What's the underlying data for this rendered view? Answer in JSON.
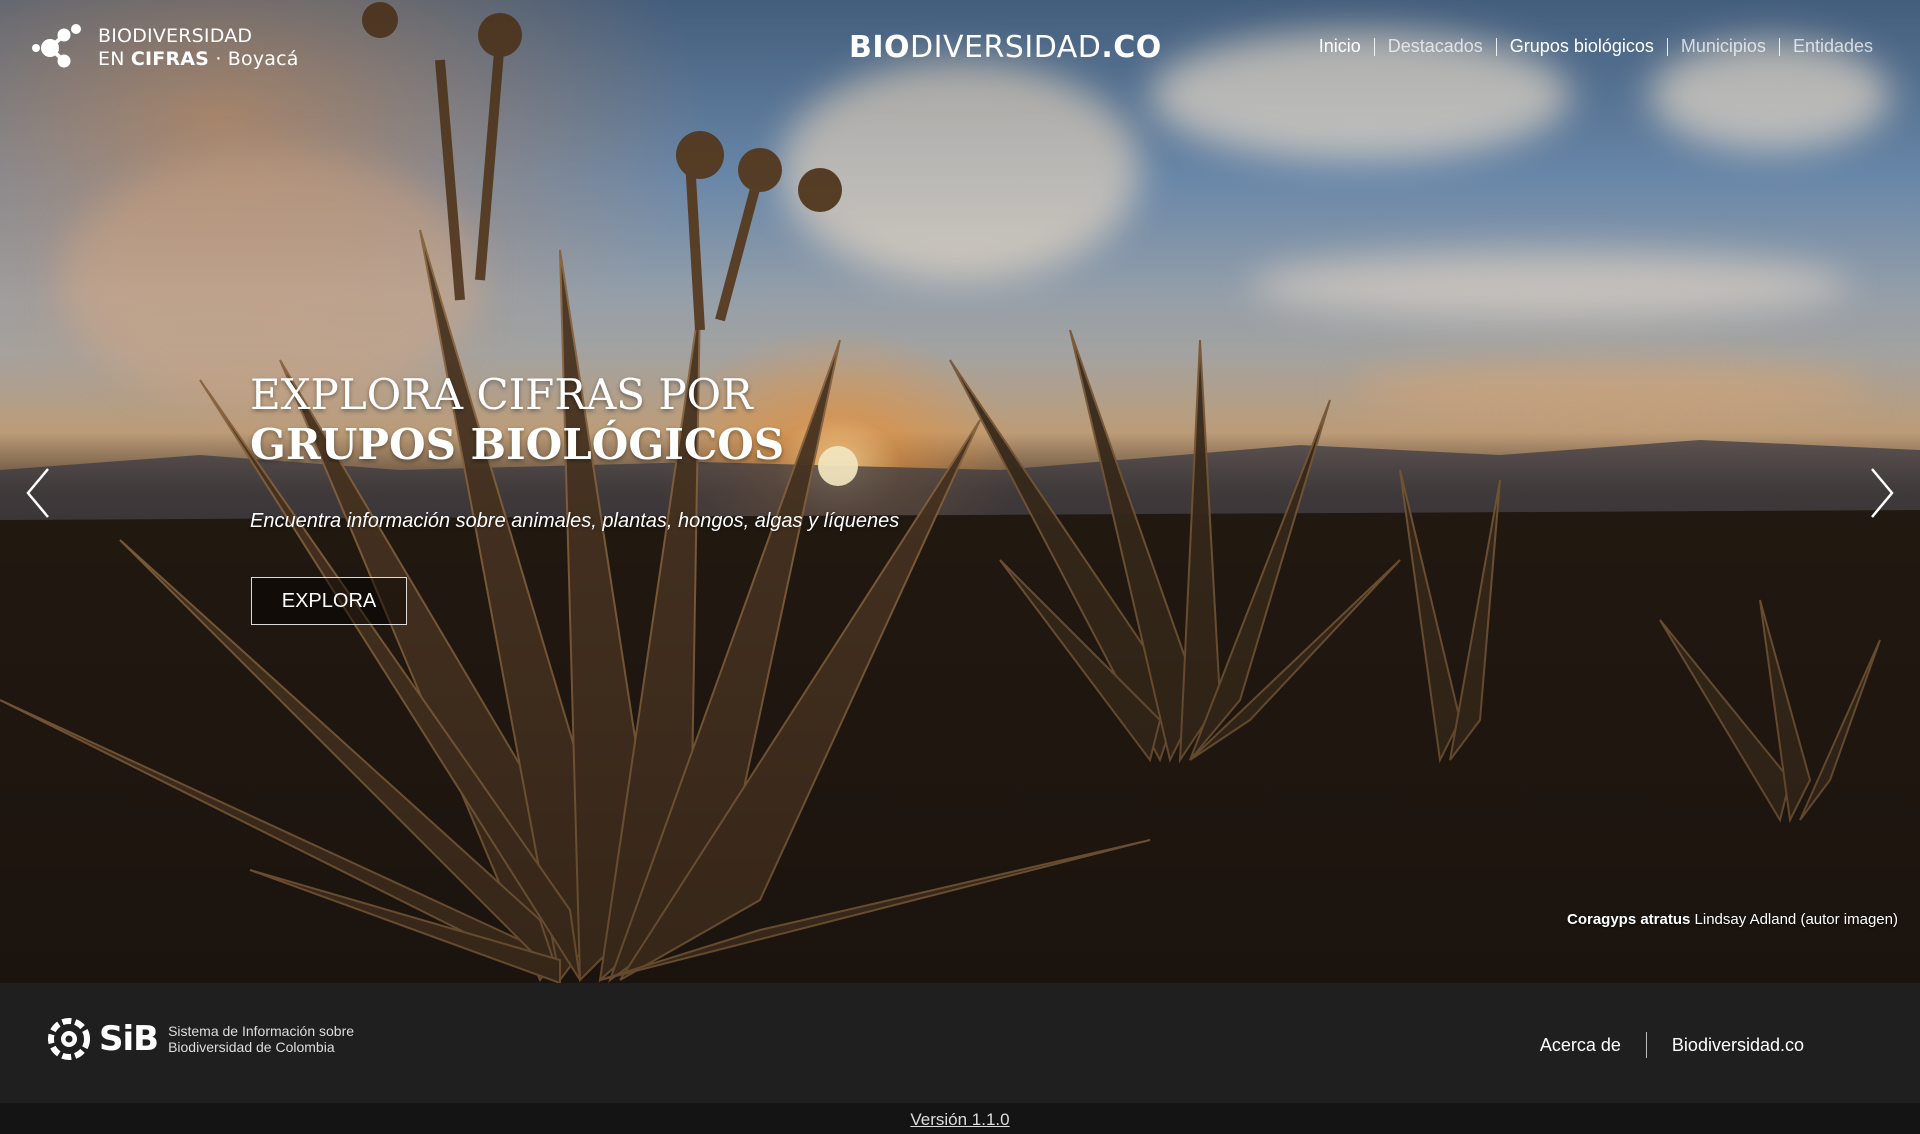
{
  "header": {
    "logo_line1": "BIODIVERSIDAD",
    "logo_line2_prefix": "EN ",
    "logo_line2_bold": "CIFRAS",
    "logo_line2_sep": " · ",
    "logo_region": "Boyacá",
    "brand_part1": "BIO",
    "brand_part2": "DIVERSIDAD",
    "brand_part3": ".CO"
  },
  "nav": {
    "items": [
      {
        "label": "Inicio"
      },
      {
        "label": "Destacados"
      },
      {
        "label": "Grupos biológicos"
      },
      {
        "label": "Municipios"
      },
      {
        "label": "Entidades"
      }
    ]
  },
  "hero": {
    "headline_line1": "EXPLORA CIFRAS POR",
    "headline_line2": "GRUPOS BIOLÓGICOS",
    "subtitle": "Encuentra información sobre animales, plantas, hongos, algas y líquenes",
    "button_label": "EXPLORA",
    "credit_species": "Coragyps atratus",
    "credit_author": " Lindsay Adland (autor imagen)"
  },
  "footer": {
    "sib_word": "SiB",
    "sib_desc_line1": "Sistema de Información sobre",
    "sib_desc_line2": "Biodiversidad de Colombia",
    "link_about": "Acerca de",
    "link_biodiversidad": "Biodiversidad.co",
    "version": "Versión 1.1.0"
  },
  "colors": {
    "footer_bg": "#1f1f1f",
    "version_bg": "#141414",
    "text": "#ffffff"
  },
  "icons": {
    "logo": "molecule-dots-icon",
    "prev": "chevron-left-icon",
    "next": "chevron-right-icon",
    "sib": "sib-gear-icon"
  }
}
